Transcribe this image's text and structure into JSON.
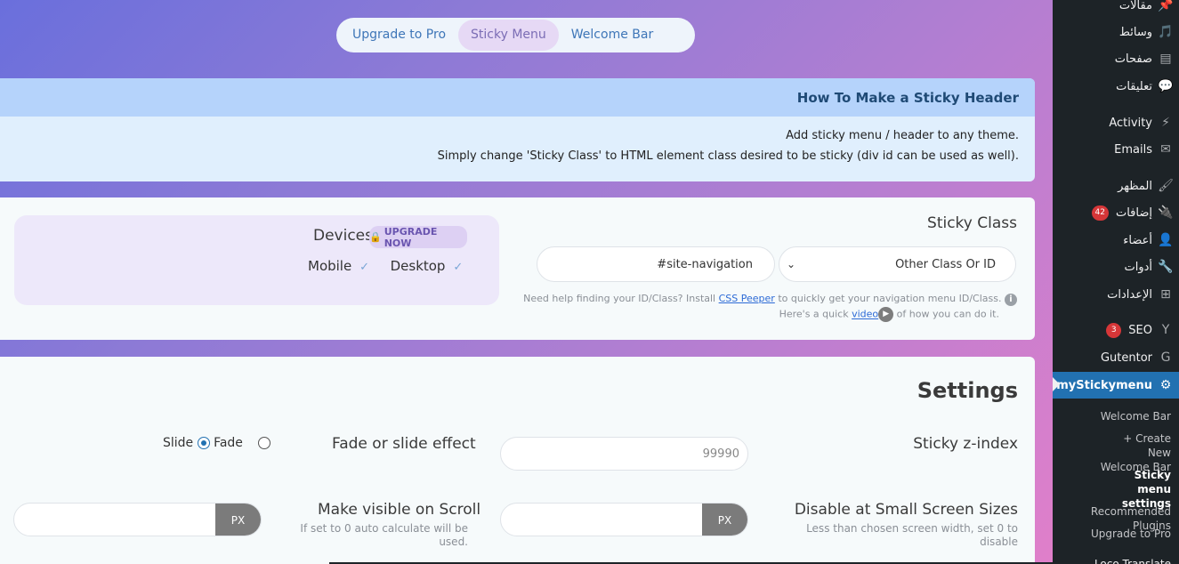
{
  "tabs": [
    "Upgrade to Pro",
    "Sticky Menu",
    "Welcome Bar"
  ],
  "info": {
    "title": "How To Make a Sticky Header",
    "line1": "Add sticky menu / header to any theme.",
    "line2": "Simply change 'Sticky Class' to HTML element class desired to be sticky (div id can be used as well)."
  },
  "sticky_class": {
    "label": "Sticky Class",
    "select_value": "Other Class Or ID",
    "input_value": "#site-navigation",
    "help_prefix": "Need help finding your ID/Class? Install",
    "help_link": "CSS Peeper",
    "help_suffix": "to quickly get your navigation menu ID/Class.",
    "help_line2_prefix": "Here's a quick",
    "help_video": "video",
    "help_line2_suffix": "of how you can do it."
  },
  "devices": {
    "label": "Devices",
    "upgrade": "UPGRADE NOW",
    "mobile": "Mobile",
    "desktop": "Desktop"
  },
  "settings": {
    "title": "Settings",
    "zindex_label": "Sticky z-index",
    "zindex_placeholder": "99990",
    "fade_label": "Fade or slide effect",
    "slide": "Slide",
    "fade": "Fade",
    "disable_label": "Disable at Small Screen Sizes",
    "disable_sub": "Less than chosen screen width, set 0 to disable",
    "visible_label": "Make visible on Scroll",
    "visible_sub": "If set to 0 auto calculate will be used.",
    "px": "PX"
  },
  "sidebar": {
    "items": [
      {
        "label": "مقالات",
        "icon": "pin-icon"
      },
      {
        "label": "وسائط",
        "icon": "media-icon"
      },
      {
        "label": "صفحات",
        "icon": "pages-icon"
      },
      {
        "label": "تعليقات",
        "icon": "comments-icon"
      },
      {
        "label": "Activity",
        "icon": "activity-icon"
      },
      {
        "label": "Emails",
        "icon": "email-icon"
      },
      {
        "label": "المظهر",
        "icon": "appearance-icon"
      },
      {
        "label": "إضافات",
        "icon": "plugins-icon",
        "badge": "42"
      },
      {
        "label": "أعضاء",
        "icon": "users-icon"
      },
      {
        "label": "أدوات",
        "icon": "tools-icon"
      },
      {
        "label": "الإعدادات",
        "icon": "settings-icon"
      },
      {
        "label": "SEO",
        "icon": "yoast-icon",
        "badge": "3"
      },
      {
        "label": "Gutentor",
        "icon": "gutentor-icon"
      },
      {
        "label": "myStickymenu",
        "icon": "gear-icon"
      }
    ],
    "submenu": [
      "Welcome Bar",
      "+ Create New Welcome Bar",
      "Sticky menu settings",
      "Recommended Plugins",
      "Upgrade to Pro",
      "Loco Translate"
    ]
  }
}
